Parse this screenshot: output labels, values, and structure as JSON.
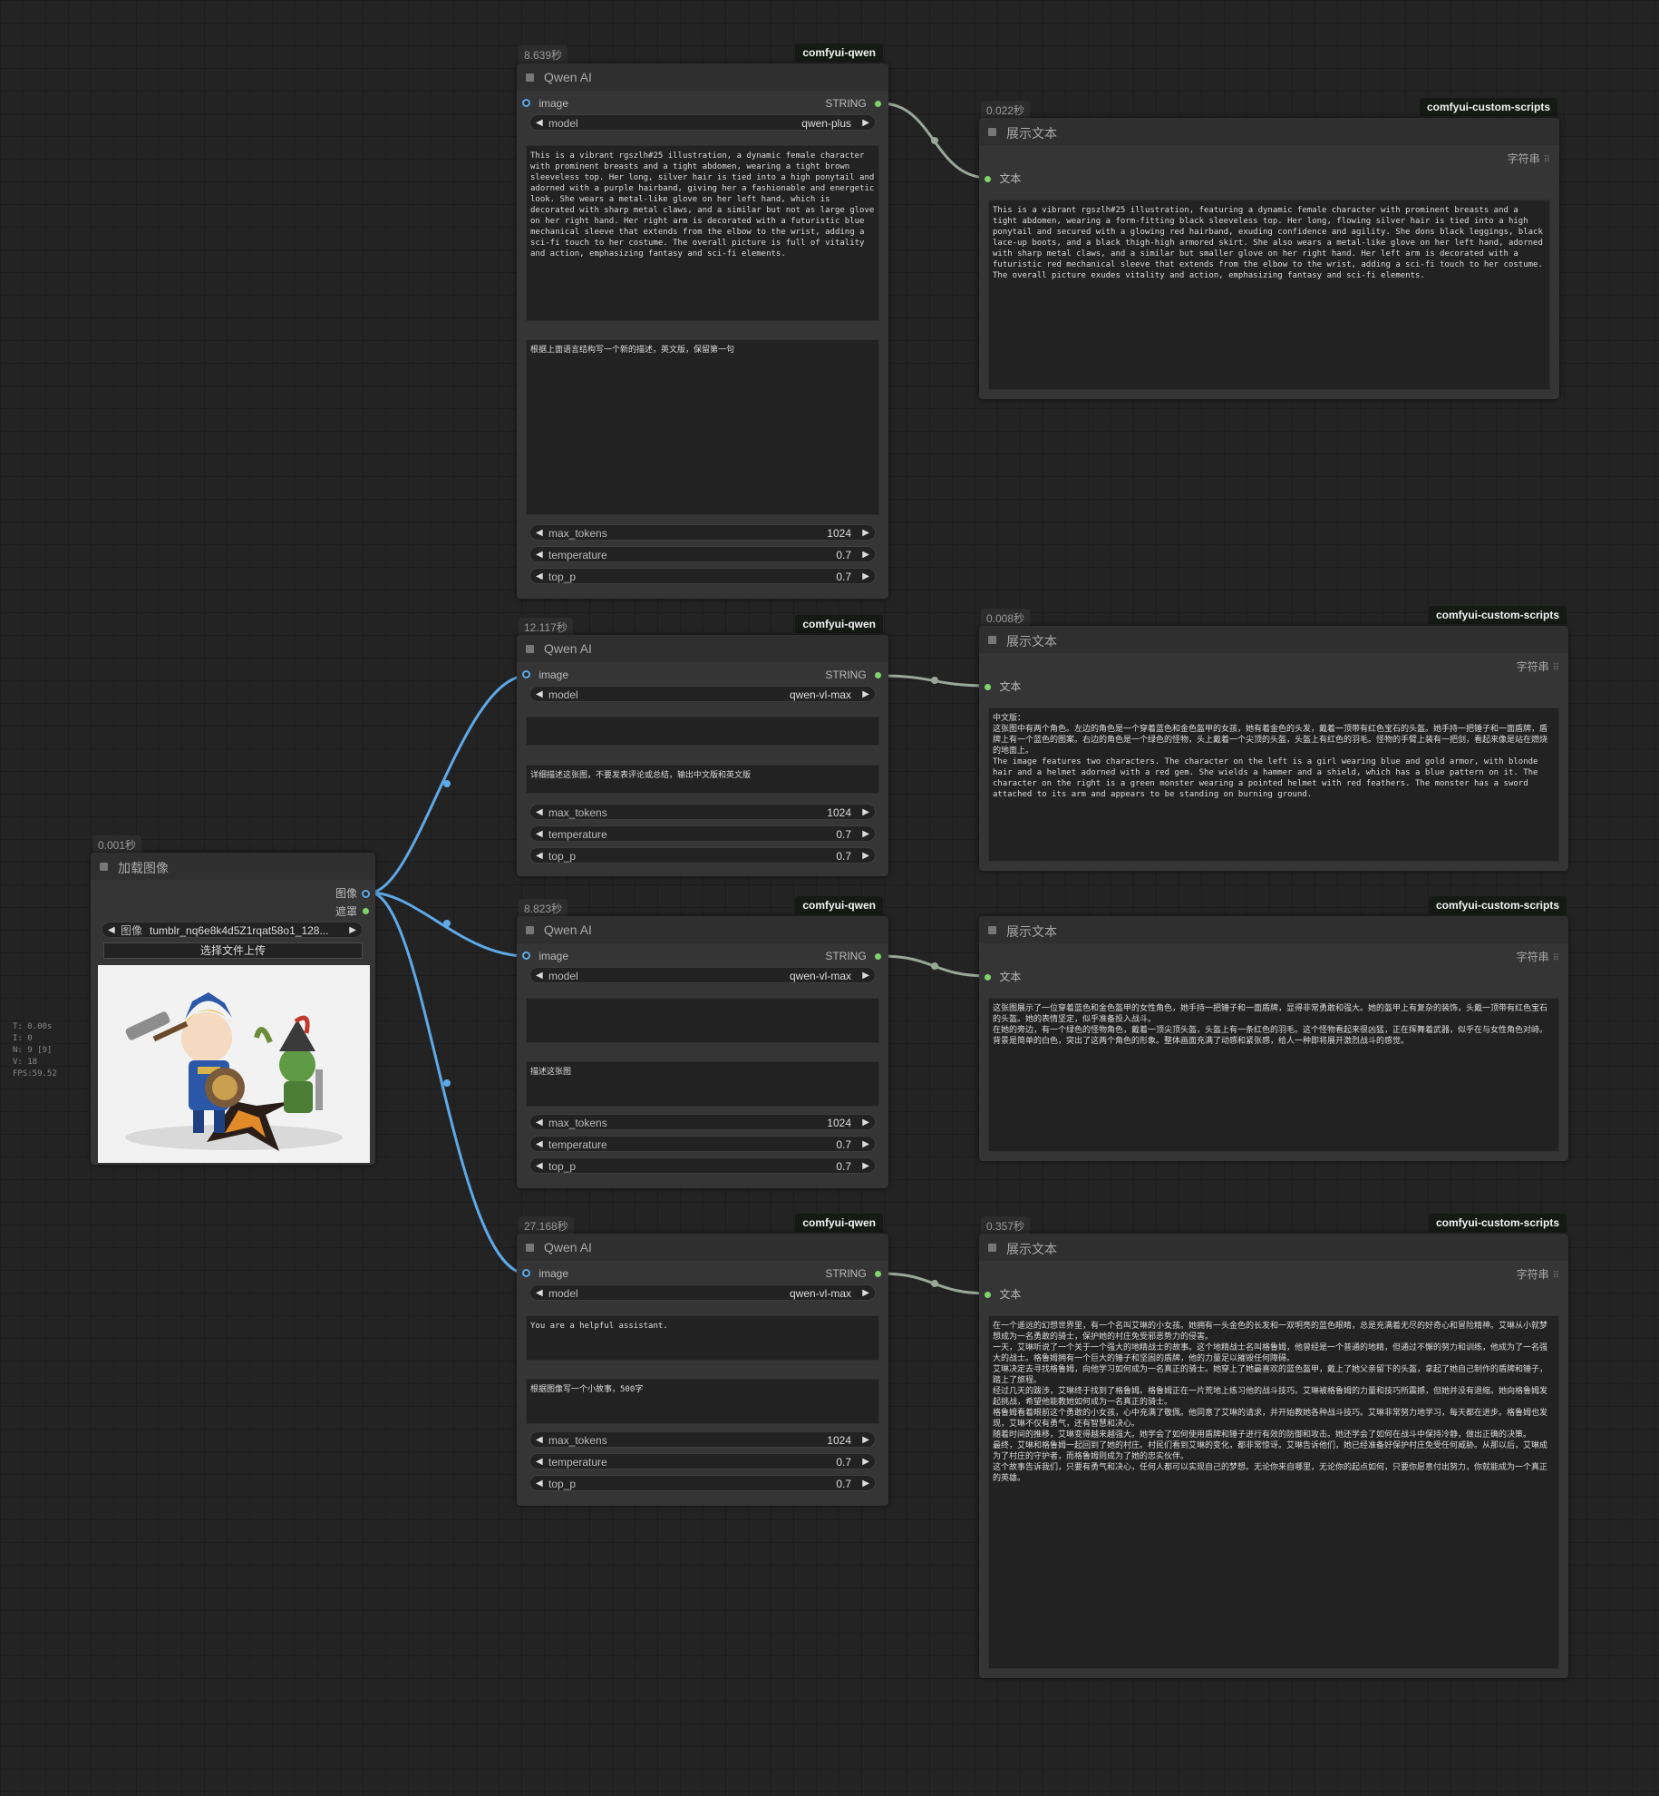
{
  "load_image": {
    "time": "0.001秒",
    "title": "加载图像",
    "out_image": "图像",
    "out_mask": "遮罩",
    "file_prefix": "图像",
    "file_name": "tumblr_nq6e8k4d5Z1rqat58o1_128...",
    "upload_label": "选择文件上传"
  },
  "qwen_nodes": [
    {
      "time": "8.639秒",
      "badge": "comfyui-qwen",
      "title": "Qwen AI",
      "in_image": "image",
      "out_string": "STRING",
      "model_label": "model",
      "model_value": "qwen-plus",
      "system_prompt": "This is a vibrant rgszlh#25 illustration, a dynamic female character with prominent breasts and a tight abdomen, wearing a tight brown sleeveless top. Her long, silver hair is tied into a high ponytail and adorned with a purple hairband, giving her a fashionable and energetic look. She wears a metal-like glove on her left hand, which is decorated with sharp metal claws, and a similar but not as large glove on her right hand. Her right arm is decorated with a futuristic blue mechanical sleeve that extends from the elbow to the wrist, adding a sci-fi touch to her costume. The overall picture is full of vitality and action, emphasizing fantasy and sci-fi elements.",
      "user_prompt": "根据上面语言结构写一个新的描述，英文版，保留第一句",
      "max_tokens_label": "max_tokens",
      "max_tokens": "1024",
      "temperature_label": "temperature",
      "temperature": "0.7",
      "top_p_label": "top_p",
      "top_p": "0.7"
    },
    {
      "time": "12.117秒",
      "badge": "comfyui-qwen",
      "title": "Qwen AI",
      "in_image": "image",
      "out_string": "STRING",
      "model_label": "model",
      "model_value": "qwen-vl-max",
      "system_prompt": "",
      "user_prompt": "详细描述这张图，不要发表评论或总结，输出中文版和英文版",
      "max_tokens_label": "max_tokens",
      "max_tokens": "1024",
      "temperature_label": "temperature",
      "temperature": "0.7",
      "top_p_label": "top_p",
      "top_p": "0.7"
    },
    {
      "time": "8.823秒",
      "badge": "comfyui-qwen",
      "title": "Qwen AI",
      "in_image": "image",
      "out_string": "STRING",
      "model_label": "model",
      "model_value": "qwen-vl-max",
      "system_prompt": "",
      "user_prompt": "描述这张图",
      "max_tokens_label": "max_tokens",
      "max_tokens": "1024",
      "temperature_label": "temperature",
      "temperature": "0.7",
      "top_p_label": "top_p",
      "top_p": "0.7"
    },
    {
      "time": "27.168秒",
      "badge": "comfyui-qwen",
      "title": "Qwen AI",
      "in_image": "image",
      "out_string": "STRING",
      "model_label": "model",
      "model_value": "qwen-vl-max",
      "system_prompt": "You are a helpful assistant.",
      "user_prompt": "根据图像写一个小故事，500字",
      "max_tokens_label": "max_tokens",
      "max_tokens": "1024",
      "temperature_label": "temperature",
      "temperature": "0.7",
      "top_p_label": "top_p",
      "top_p": "0.7"
    }
  ],
  "show_nodes": [
    {
      "time": "0.022秒",
      "badge": "comfyui-custom-scripts",
      "title": "展示文本",
      "string_label": "字符串",
      "in_text": "文本",
      "text": "This is a vibrant rgszlh#25 illustration, featuring a dynamic female character with prominent breasts and a tight abdomen, wearing a form-fitting black sleeveless top. Her long, flowing silver hair is tied into a high ponytail and secured with a glowing red hairband, exuding confidence and agility. She dons black leggings, black lace-up boots, and a black thigh-high armored skirt. She also wears a metal-like glove on her left hand, adorned with sharp metal claws, and a similar but smaller glove on her right hand. Her left arm is decorated with a futuristic red mechanical sleeve that extends from the elbow to the wrist, adding a sci-fi touch to her costume. The overall picture exudes vitality and action, emphasizing fantasy and sci-fi elements."
    },
    {
      "time": "0.008秒",
      "badge": "comfyui-custom-scripts",
      "title": "展示文本",
      "string_label": "字符串",
      "in_text": "文本",
      "text": "中文版：\n这张图中有两个角色。左边的角色是一个穿着蓝色和金色盔甲的女孩，她有着金色的头发，戴着一顶带有红色宝石的头盔。她手持一把锤子和一面盾牌，盾牌上有一个蓝色的图案。右边的角色是一个绿色的怪物，头上戴着一个尖顶的头盔，头盔上有红色的羽毛。怪物的手臂上装有一把剑，看起来像是站在燃烧的地面上。\nThe image features two characters. The character on the left is a girl wearing blue and gold armor, with blonde hair and a helmet adorned with a red gem. She wields a hammer and a shield, which has a blue pattern on it. The character on the right is a green monster wearing a pointed helmet with red feathers. The monster has a sword attached to its arm and appears to be standing on burning ground."
    },
    {
      "time": "",
      "badge": "comfyui-custom-scripts",
      "title": "展示文本",
      "string_label": "字符串",
      "in_text": "文本",
      "text": "这张图展示了一位穿着蓝色和金色盔甲的女性角色，她手持一把锤子和一面盾牌，显得非常勇敢和强大。她的盔甲上有复杂的装饰，头戴一顶带有红色宝石的头盔。她的表情坚定，似乎准备投入战斗。\n在她的旁边，有一个绿色的怪物角色，戴着一顶尖顶头盔，头盔上有一条红色的羽毛。这个怪物看起来很凶猛，正在挥舞着武器，似乎在与女性角色对峙。\n背景是简单的白色，突出了这两个角色的形象。整体画面充满了动感和紧张感，给人一种即将展开激烈战斗的感觉。"
    },
    {
      "time": "0.357秒",
      "badge": "comfyui-custom-scripts",
      "title": "展示文本",
      "string_label": "字符串",
      "in_text": "文本",
      "text": "在一个遥远的幻想世界里，有一个名叫艾琳的小女孩。她拥有一头金色的长发和一双明亮的蓝色眼睛，总是充满着无尽的好奇心和冒险精神。艾琳从小就梦想成为一名勇敢的骑士，保护她的村庄免受邪恶势力的侵害。\n一天，艾琳听说了一个关于一个强大的地精战士的故事。这个地精战士名叫格鲁姆，他曾经是一个普通的地精，但通过不懈的努力和训练，他成为了一名强大的战士。格鲁姆拥有一个巨大的锤子和坚固的盾牌，他的力量足以摧毁任何障碍。\n艾琳决定去寻找格鲁姆，向他学习如何成为一名真正的骑士。她穿上了她最喜欢的蓝色盔甲，戴上了她父亲留下的头盔，拿起了她自己制作的盾牌和锤子，踏上了旅程。\n经过几天的跋涉，艾琳终于找到了格鲁姆。格鲁姆正在一片荒地上练习他的战斗技巧。艾琳被格鲁姆的力量和技巧所震撼，但她并没有退缩。她向格鲁姆发起挑战，希望他能教她如何成为一名真正的骑士。\n格鲁姆看着眼前这个勇敢的小女孩，心中充满了敬佩。他同意了艾琳的请求，并开始教她各种战斗技巧。艾琳非常努力地学习，每天都在进步。格鲁姆也发现，艾琳不仅有勇气，还有智慧和决心。\n随着时间的推移，艾琳变得越来越强大。她学会了如何使用盾牌和锤子进行有效的防御和攻击。她还学会了如何在战斗中保持冷静，做出正确的决策。\n最终，艾琳和格鲁姆一起回到了她的村庄。村民们看到艾琳的变化，都非常惊讶。艾琳告诉他们，她已经准备好保护村庄免受任何威胁。从那以后，艾琳成为了村庄的守护者，而格鲁姆则成为了她的忠实伙伴。\n这个故事告诉我们，只要有勇气和决心，任何人都可以实现自己的梦想。无论你来自哪里，无论你的起点如何，只要你愿意付出努力，你就能成为一个真正的英雄。"
    }
  ],
  "stats": {
    "t": "T: 0.00s",
    "i": "I: 0",
    "n": "N: 9 [9]",
    "v": "V: 18",
    "fps": "FPS:59.52"
  }
}
